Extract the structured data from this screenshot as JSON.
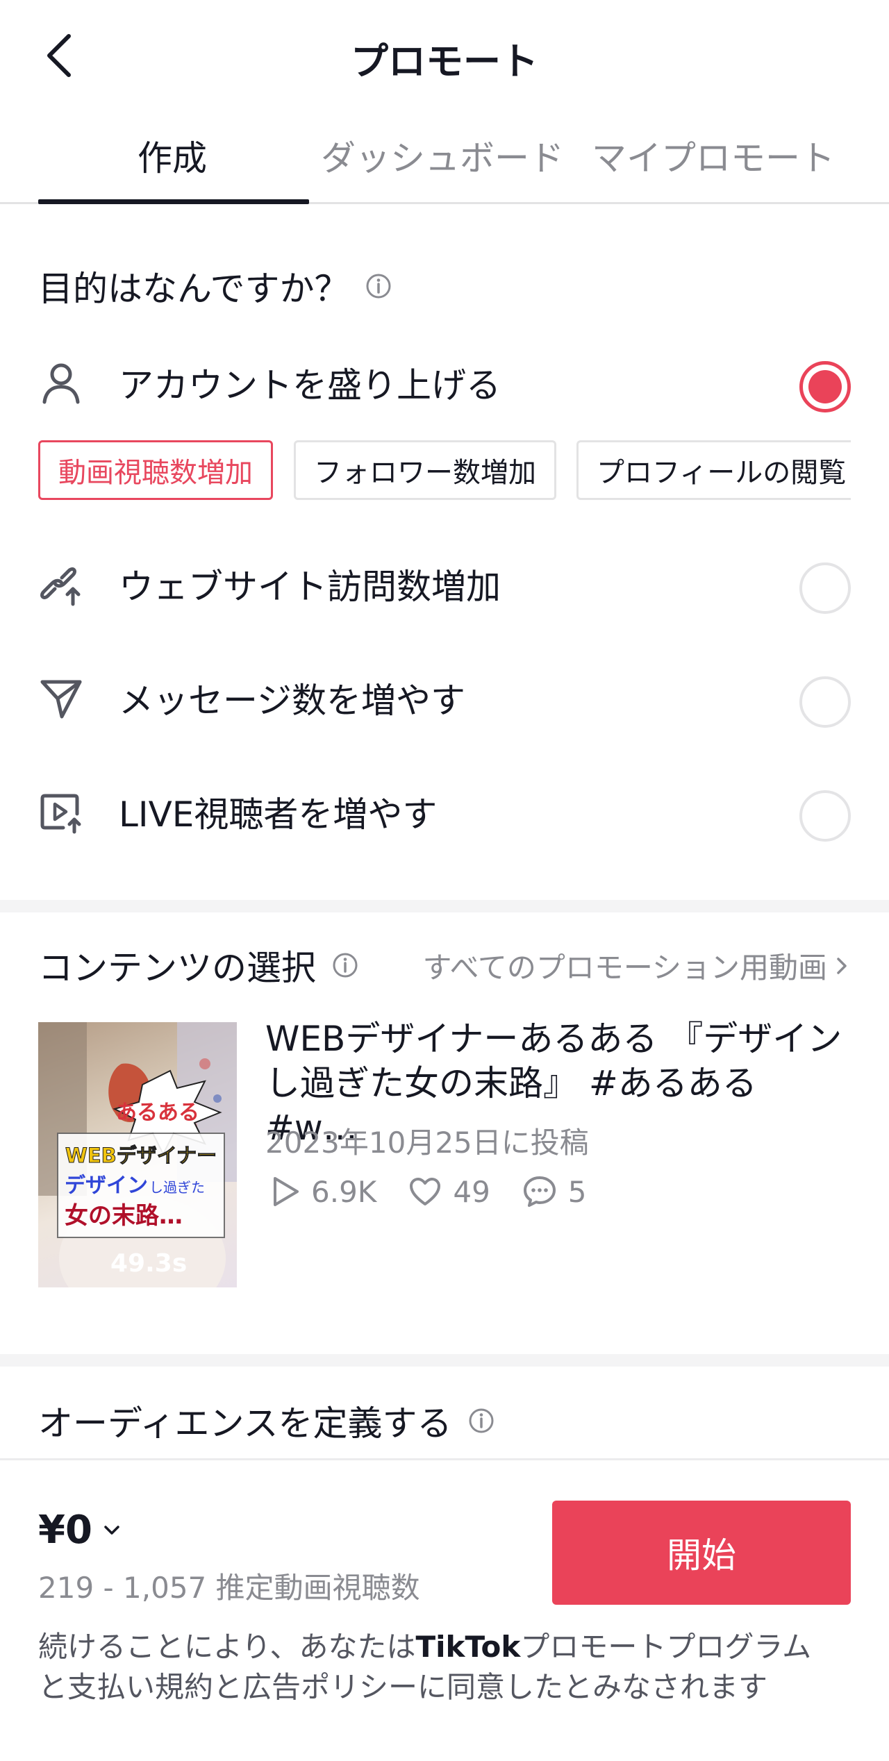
{
  "header": {
    "title": "プロモート"
  },
  "tabs": [
    {
      "label": "作成"
    },
    {
      "label": "ダッシュボード"
    },
    {
      "label": "マイプロモート"
    }
  ],
  "goal": {
    "question": "目的はなんですか？",
    "options": [
      {
        "label": "アカウントを盛り上げる",
        "icon": "person-icon",
        "selected": true
      },
      {
        "label": "ウェブサイト訪問数増加",
        "icon": "link-upload-icon",
        "selected": false
      },
      {
        "label": "メッセージ数を増やす",
        "icon": "send-icon",
        "selected": false
      },
      {
        "label": "LIVE視聴者を増やす",
        "icon": "live-video-icon",
        "selected": false
      }
    ],
    "chips": [
      {
        "label": "動画視聴数増加",
        "selected": true
      },
      {
        "label": "フォロワー数増加",
        "selected": false
      },
      {
        "label": "プロフィールの閲覧",
        "selected": false
      }
    ]
  },
  "content": {
    "title": "コンテンツの選択",
    "all_link": "すべてのプロモーション用動画",
    "video": {
      "title": "WEBデザイナーあるある 『デザインし過ぎた女の末路』 #あるある #w…",
      "date": "2023年10月25日に投稿",
      "views": "6.9K",
      "likes": "49",
      "comments": "5",
      "duration": "49.3s",
      "thumbnail_text": {
        "line1": "あるある",
        "line2": "WEBデザイナー",
        "line3a": "デザイン",
        "line3b": "し過ぎた",
        "line4": "女の末路…"
      }
    }
  },
  "audience": {
    "title": "オーディエンスを定義する"
  },
  "footer": {
    "price": "¥0",
    "estimate": "219 - 1,057 推定動画視聴数",
    "start_label": "開始",
    "legal_prefix": "続けることにより、あなたは",
    "legal_brand": "TikTok",
    "legal_suffix": "プロモートプログラムと支払い規約と広告ポリシーに同意したとみなされます"
  },
  "colors": {
    "accent": "#ea4359",
    "text": "#161823",
    "muted": "#8a8b91"
  }
}
